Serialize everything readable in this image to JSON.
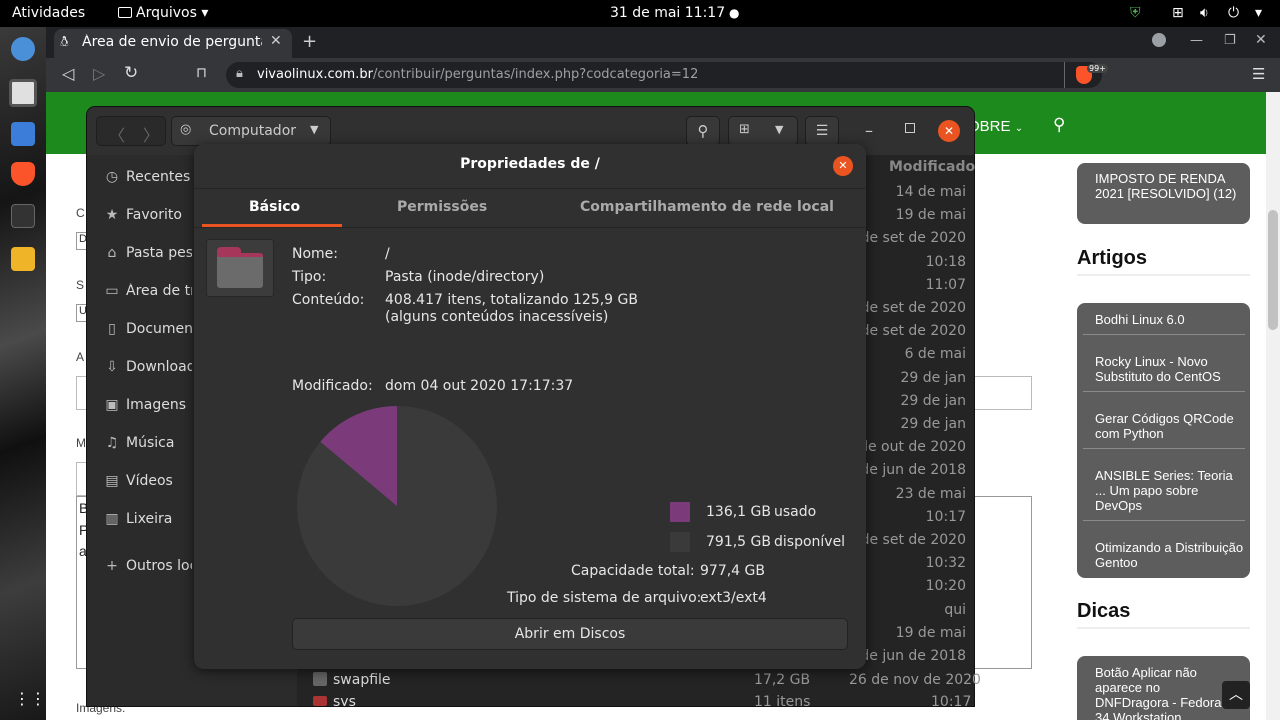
{
  "topbar": {
    "activities": "Atividades",
    "app_menu": "Arquivos",
    "datetime": "31 de mai  11:17"
  },
  "browser": {
    "tab_title": "Área de envio de pergunta",
    "url_domain": "vivaolinux.com.br",
    "url_path": "/contribuir/perguntas/index.php?codcategoria=12",
    "badge": "99+"
  },
  "site": {
    "nav_partial": "OBRE",
    "sidebar_top_item": "IMPOSTO DE RENDA 2021 [RESOLVIDO] (12)",
    "artigos_heading": "Artigos",
    "artigos": [
      "Bodhi Linux 6.0",
      "Rocky Linux - Novo Substituto do CentOS",
      "Gerar Códigos QRCode com Python",
      "ANSIBLE Series: Teoria ... Um papo sobre DevOps",
      "Otimizando a Distribuição Gentoo"
    ],
    "dicas_heading": "Dicas",
    "dicas": [
      "Botão Aplicar não aparece no DNFDragora - Fedora 34 Workstation"
    ],
    "form_label_imagens": "Imagens:",
    "form_fragments": [
      "C",
      "D",
      "S",
      "U",
      "A",
      "M",
      "B",
      "P",
      "a"
    ]
  },
  "files": {
    "location": "Computador",
    "column_modified": "Modificado",
    "sidebar": [
      "Recentes",
      "Favorito",
      "Pasta pess",
      "Área de tr",
      "Document",
      "Download",
      "Imagens",
      "Música",
      "Vídeos",
      "Lixeira",
      "Outros loc"
    ],
    "modified": [
      "14 de mai",
      "19 de mai",
      "de set de 2020",
      "10:18",
      "11:07",
      "de set de 2020",
      "de set de 2020",
      "6 de mai",
      "29 de jan",
      "29 de jan",
      "29 de jan",
      "de out de 2020",
      "de jun de 2018",
      "23 de mai",
      "10:17",
      "de set de 2020",
      "10:32",
      "10:20",
      "qui",
      "19 de mai",
      "de jun de 2018"
    ],
    "swapfile": {
      "name": "swapfile",
      "size": "17,2 GB",
      "modified": "26 de nov de 2020"
    },
    "sys": {
      "name": "sys",
      "size": "11 itens",
      "modified": "10:17"
    }
  },
  "dialog": {
    "title": "Propriedades de /",
    "tabs": [
      "Básico",
      "Permissões",
      "Compartilhamento de rede local"
    ],
    "name_label": "Nome:",
    "name_value": "/",
    "type_label": "Tipo:",
    "type_value": "Pasta (inode/directory)",
    "content_label": "Conteúdo:",
    "content_value": "408.417 itens, totalizando 125,9 GB",
    "content_note": "(alguns conteúdos inacessíveis)",
    "modified_label": "Modificado:",
    "modified_value": "dom 04 out 2020 17:17:37",
    "used_value": "136,1 GB",
    "used_label": "usado",
    "free_value": "791,5 GB",
    "free_label": "disponível",
    "capacity_label": "Capacidade total:",
    "capacity_value": "977,4 GB",
    "fs_label": "Tipo de sistema de arquivo:",
    "fs_value": "ext3/ext4",
    "open_button": "Abrir em Discos",
    "used_fraction": 0.139,
    "used_color": "#7b3b7b",
    "free_color": "#3a3a3a"
  },
  "colors": {
    "site_green": "#1d8a1d",
    "close_red": "#e95420"
  }
}
